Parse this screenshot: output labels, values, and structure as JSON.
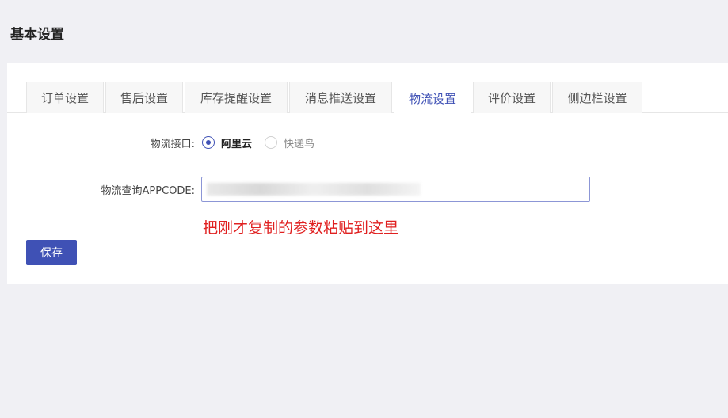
{
  "page": {
    "title": "基本设置"
  },
  "tabs": [
    {
      "label": "订单设置"
    },
    {
      "label": "售后设置"
    },
    {
      "label": "库存提醒设置"
    },
    {
      "label": "消息推送设置"
    },
    {
      "label": "物流设置"
    },
    {
      "label": "评价设置"
    },
    {
      "label": "侧边栏设置"
    }
  ],
  "active_tab": "物流设置",
  "form": {
    "logistics_api": {
      "label": "物流接口:",
      "options": [
        {
          "label": "阿里云",
          "checked": true
        },
        {
          "label": "快递鸟",
          "checked": false
        }
      ]
    },
    "appcode": {
      "label": "物流查询APPCODE:",
      "value": ""
    },
    "hint": "把刚才复制的参数粘贴到这里"
  },
  "actions": {
    "save_label": "保存"
  },
  "colors": {
    "accent": "#3f51b5",
    "hint": "#e02020",
    "background": "#f0f0f4"
  }
}
